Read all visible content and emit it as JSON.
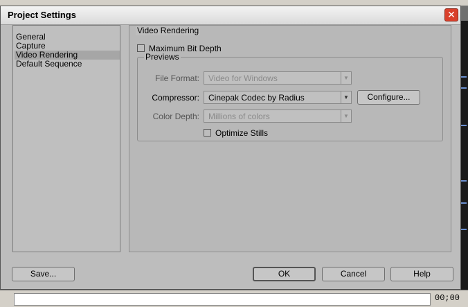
{
  "dialog": {
    "title": "Project Settings",
    "close_label": "✕"
  },
  "categories": [
    {
      "label": "General",
      "selected": false
    },
    {
      "label": "Capture",
      "selected": false
    },
    {
      "label": "Video Rendering",
      "selected": true
    },
    {
      "label": "Default Sequence",
      "selected": false
    }
  ],
  "video_rendering": {
    "group_label": "Video Rendering",
    "max_bit_depth": {
      "label": "Maximum Bit Depth",
      "checked": false
    },
    "previews": {
      "group_label": "Previews",
      "file_format": {
        "label": "File Format:",
        "value": "Video for Windows"
      },
      "compressor": {
        "label": "Compressor:",
        "value": "Cinepak Codec by Radius"
      },
      "color_depth": {
        "label": "Color Depth:",
        "value": "Millions of colors"
      },
      "configure_label": "Configure...",
      "optimize_stills": {
        "label": "Optimize Stills",
        "checked": false
      }
    }
  },
  "buttons": {
    "save": "Save...",
    "ok": "OK",
    "cancel": "Cancel",
    "help": "Help"
  },
  "background": {
    "timecode": "00;00"
  }
}
